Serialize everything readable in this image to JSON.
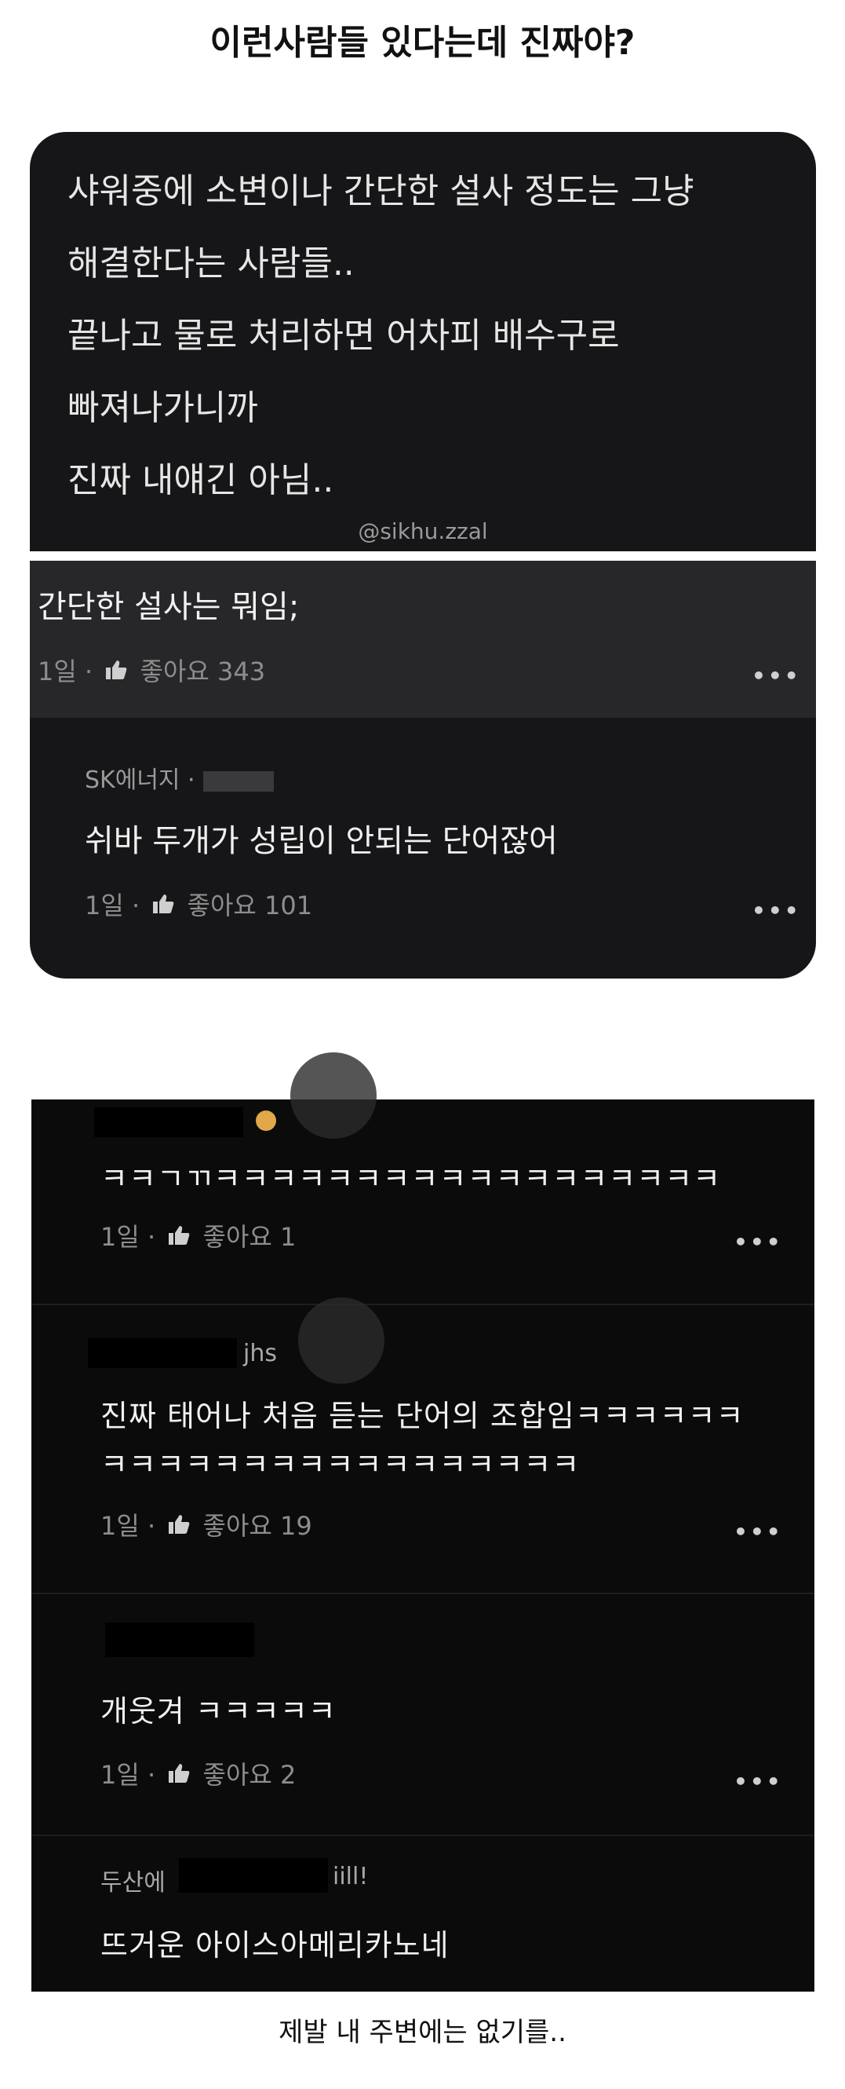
{
  "page_title": "이런사람들 있다는데 진짜야?",
  "post": {
    "lines": [
      "샤워중에 소변이나 간단한 설사 정도는 그냥",
      "해결한다는 사람들..",
      "끝나고 물로 처리하면 어차피 배수구로",
      "빠져나가니까",
      "진짜 내얘긴 아님.."
    ],
    "watermark": "@sikhu.zzal"
  },
  "comment1": {
    "text": "간단한 설사는 뭐임;",
    "time": "1일",
    "like_icon": "thumbs-up-icon",
    "likes_label": "좋아요 343"
  },
  "reply1": {
    "name": "SK에너지 ·",
    "text": "쉬바 두개가 성립이 안되는 단어잖어",
    "time": "1일",
    "likes_label": "좋아요 101"
  },
  "comments2": [
    {
      "username": "",
      "text_lines": [
        "ㅋㅋㄱㄲㅋㅋㅋㅋㅋㅋㅋㅋㅋㅋㅋㅋㅋㅋㅋㅋㅋㅋ"
      ],
      "time": "1일",
      "likes_label": "좋아요 1"
    },
    {
      "username": "jhs",
      "text_lines": [
        "진짜 태어나 처음 듣는 단어의 조합임ㅋㅋㅋㅋㅋㅋ",
        "ㅋㅋㅋㅋㅋㅋㅋㅋㅋㅋㅋㅋㅋㅋㅋㅋㅋ"
      ],
      "time": "1일",
      "likes_label": "좋아요 19"
    },
    {
      "username": "",
      "text_lines": [
        "개웃겨 ㅋㅋㅋㅋㅋ"
      ],
      "time": "1일",
      "likes_label": "좋아요 2"
    },
    {
      "username_prefix": "두산에",
      "username_suffix": "iill!",
      "text_lines": [
        "뜨거운 아이스아메리카노네"
      ]
    }
  ],
  "more_label": "•••",
  "meta_separator": "·",
  "caption": "제발 내 주변에는 없기를.."
}
